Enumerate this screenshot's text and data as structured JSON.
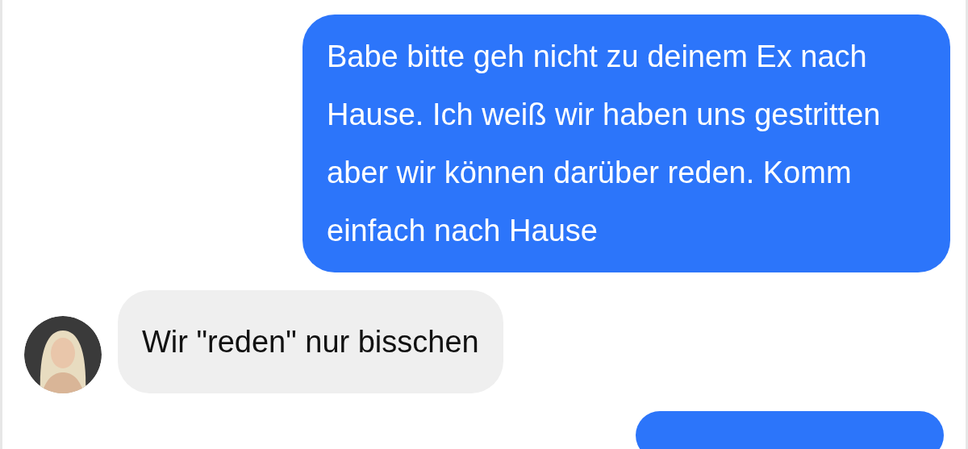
{
  "messages": [
    {
      "kind": "sent",
      "text": "Babe bitte geh nicht zu deinem Ex nach Hause. Ich weiß wir haben uns gestritten aber wir können darüber reden. Komm einfach nach Hause"
    },
    {
      "kind": "received",
      "text": "Wir \"reden\" nur bisschen"
    },
    {
      "kind": "sent"
    }
  ]
}
